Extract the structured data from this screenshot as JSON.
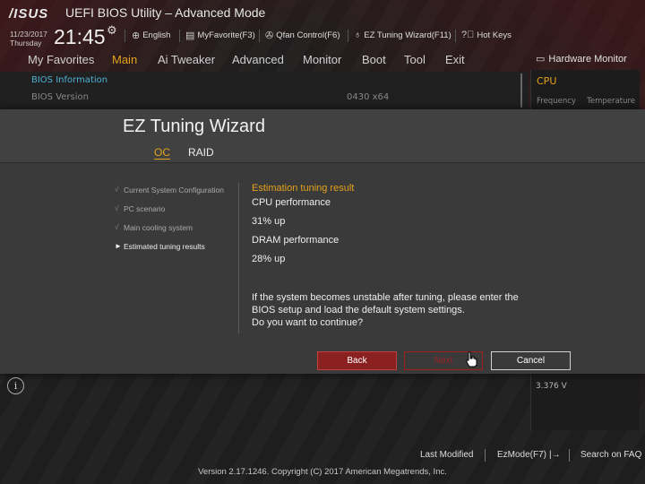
{
  "header": {
    "logo": "/ISUS",
    "title": "UEFI BIOS Utility – Advanced Mode",
    "date": "11/23/2017",
    "day": "Thursday",
    "time": "21:45",
    "tools": {
      "language": "English",
      "my_favorite": "MyFavorite(F3)",
      "qfan": "Qfan Control(F6)",
      "ez_tuning": "EZ Tuning Wizard(F11)",
      "hot_keys": "Hot Keys"
    }
  },
  "menu": {
    "items": [
      "My Favorites",
      "Main",
      "Ai Tweaker",
      "Advanced",
      "Monitor",
      "Boot",
      "Tool",
      "Exit"
    ],
    "active": "Main"
  },
  "main": {
    "bios_information": "BIOS Information",
    "bios_version_label": "BIOS Version",
    "bios_version_value": "0430  x64"
  },
  "hardware_monitor": {
    "title": "Hardware Monitor",
    "cpu": "CPU",
    "frequency": "Frequency",
    "temperature": "Temperature",
    "voltage": "3.376 V"
  },
  "dialog": {
    "title": "EZ Tuning Wizard",
    "tabs": [
      "OC",
      "RAID"
    ],
    "active_tab": "OC",
    "steps": [
      {
        "label": "Current System Configuration",
        "mark": "√"
      },
      {
        "label": "PC scenario",
        "mark": "√"
      },
      {
        "label": "Main cooling system",
        "mark": "√"
      },
      {
        "label": "Estimated tuning results",
        "mark": "►"
      }
    ],
    "result_title": "Estimation tuning result",
    "cpu_perf_label": "CPU performance",
    "cpu_perf_value": "31% up",
    "dram_perf_label": "DRAM performance",
    "dram_perf_value": "28% up",
    "warning_line1": "If the system becomes unstable after tuning, please enter the",
    "warning_line2": "BIOS setup and load the default system settings.",
    "warning_line3": "Do you want to continue?",
    "buttons": {
      "back": "Back",
      "next": "Next",
      "cancel": "Cancel"
    }
  },
  "footer": {
    "last_modified": "Last Modified",
    "ezmode": "EzMode(F7)",
    "search_faq": "Search on FAQ",
    "copyright": "Version 2.17.1246. Copyright (C) 2017 American Megatrends, Inc."
  },
  "colors": {
    "accent": "#e3a21a",
    "link_blue": "#4fb2d6",
    "button_red": "#8a2020"
  }
}
